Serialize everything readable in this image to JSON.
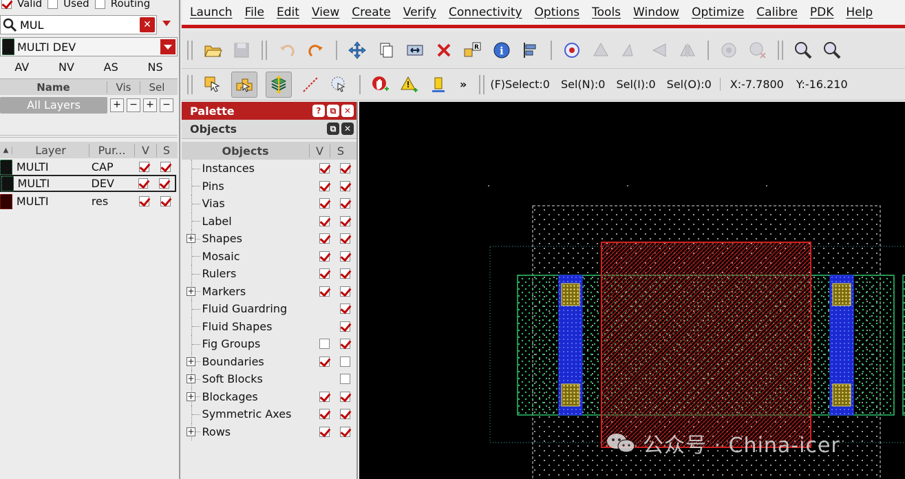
{
  "filters": {
    "valid": "Valid",
    "used": "Used",
    "routing": "Routing"
  },
  "search": {
    "value": "MUL"
  },
  "layer_select": {
    "value": "MULTI DEV"
  },
  "vis_tabs": [
    "AV",
    "NV",
    "AS",
    "NS"
  ],
  "name_table": {
    "name": "Name",
    "vis": "Vis",
    "sel": "Sel",
    "all_layers": "All Layers",
    "btns": [
      "+",
      "−",
      "+",
      "−"
    ]
  },
  "layer_table": {
    "headers": {
      "layer": "Layer",
      "purpose": "Pur...",
      "v": "V",
      "s": "S"
    },
    "rows": [
      {
        "layer": "MULTI",
        "purpose": "CAP"
      },
      {
        "layer": "MULTI",
        "purpose": "DEV"
      },
      {
        "layer": "MULTI",
        "purpose": "res"
      }
    ]
  },
  "menu": [
    "Launch",
    "File",
    "Edit",
    "View",
    "Create",
    "Verify",
    "Connectivity",
    "Options",
    "Tools",
    "Window",
    "Optimize",
    "Calibre",
    "PDK",
    "Help"
  ],
  "status": {
    "fselect": "(F)Select:0",
    "seln": "Sel(N):0",
    "seli": "Sel(I):0",
    "selo": "Sel(O):0",
    "x": "X:-7.7800",
    "y": "Y:-16.210",
    "more": "»"
  },
  "palette": {
    "title": "Palette",
    "objects_title": "Objects",
    "headers": {
      "objects": "Objects",
      "v": "V",
      "s": "S"
    },
    "items": [
      {
        "label": "Instances",
        "expandable": false,
        "v": true,
        "s": true
      },
      {
        "label": "Pins",
        "expandable": false,
        "v": true,
        "s": true
      },
      {
        "label": "Vias",
        "expandable": false,
        "v": true,
        "s": true
      },
      {
        "label": "Label",
        "expandable": false,
        "v": true,
        "s": true
      },
      {
        "label": "Shapes",
        "expandable": true,
        "v": true,
        "s": true
      },
      {
        "label": "Mosaic",
        "expandable": false,
        "v": true,
        "s": true
      },
      {
        "label": "Rulers",
        "expandable": false,
        "v": true,
        "s": true
      },
      {
        "label": "Markers",
        "expandable": true,
        "v": true,
        "s": true
      },
      {
        "label": "Fluid Guardring",
        "expandable": false,
        "v": null,
        "s": true
      },
      {
        "label": "Fluid Shapes",
        "expandable": false,
        "v": null,
        "s": true
      },
      {
        "label": "Fig Groups",
        "expandable": false,
        "v": false,
        "s": true
      },
      {
        "label": "Boundaries",
        "expandable": true,
        "v": true,
        "s": false
      },
      {
        "label": "Soft Blocks",
        "expandable": true,
        "v": null,
        "s": false
      },
      {
        "label": "Blockages",
        "expandable": true,
        "v": true,
        "s": true
      },
      {
        "label": "Symmetric Axes",
        "expandable": false,
        "v": true,
        "s": true
      },
      {
        "label": "Rows",
        "expandable": true,
        "v": true,
        "s": true
      }
    ]
  },
  "watermark": "公众号 · China-icer",
  "colors": {
    "accent_red": "#c71515",
    "poly_red": "#d02020",
    "diff_green": "#2ec26a",
    "metal_blue": "#2a3cff",
    "via_yellow": "#e8d85a"
  }
}
